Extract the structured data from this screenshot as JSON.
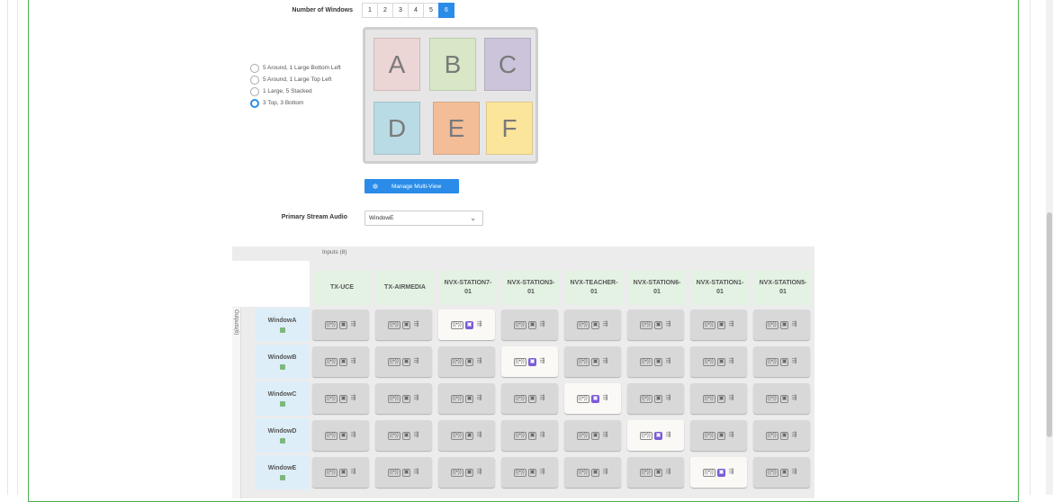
{
  "number_of_windows": {
    "label": "Number of Windows",
    "options": [
      "1",
      "2",
      "3",
      "4",
      "5",
      "6"
    ],
    "selected": "6"
  },
  "layouts": [
    {
      "label": "5 Around, 1 Large Bottom Left",
      "checked": false
    },
    {
      "label": "5 Around, 1 Large Top Left",
      "checked": false
    },
    {
      "label": "1 Large, 5 Stacked",
      "checked": false
    },
    {
      "label": "3 Top, 3 Bottom",
      "checked": true
    }
  ],
  "preview_tiles": [
    {
      "letter": "A",
      "color": "#ecd5d5"
    },
    {
      "letter": "B",
      "color": "#d8e7c6"
    },
    {
      "letter": "C",
      "color": "#ccc4db"
    },
    {
      "letter": "D",
      "color": "#b9dbe6"
    },
    {
      "letter": "E",
      "color": "#f3bd98"
    },
    {
      "letter": "F",
      "color": "#fbe59b"
    }
  ],
  "manage_button": "Manage Multi-View",
  "primary_audio": {
    "label": "Primary Stream Audio",
    "value": "WindowE"
  },
  "grid": {
    "inputs_label": "Inputs (8)",
    "outputs_label": "Outputs(6)",
    "inputs": [
      "TX-UCE",
      "TX-AIRMEDIA",
      "NVX-STATION7-01",
      "NVX-STATION3-01",
      "NVX-TEACHER-01",
      "NVX-STATION6-01",
      "NVX-STATION1-01",
      "NVX-STATION5-01"
    ],
    "outputs": [
      "WindowA",
      "WindowB",
      "WindowC",
      "WindowD",
      "WindowE"
    ],
    "routes": [
      2,
      3,
      4,
      5,
      6
    ]
  },
  "icons": {
    "audio": "((•))",
    "video": "▣",
    "usb": "⇶"
  },
  "colors": {
    "accent": "#2a8ce8",
    "frame": "#4caf50",
    "routed_video": "#7a5cd6"
  }
}
